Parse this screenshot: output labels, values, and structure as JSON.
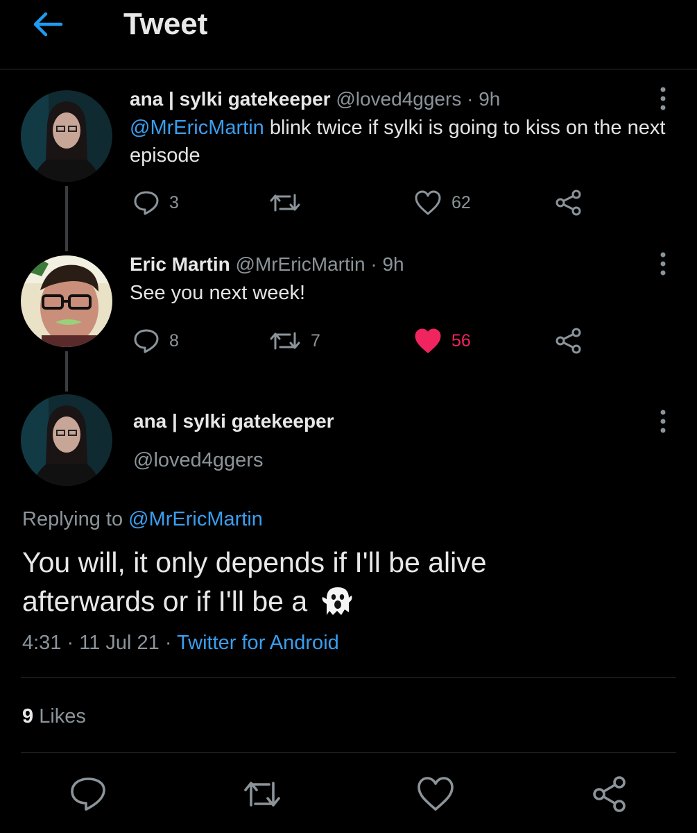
{
  "header": {
    "title": "Tweet",
    "back_icon": "arrow-left-icon",
    "accent": "#1d9bf0"
  },
  "tweets": [
    {
      "name": "ana | sylki gatekeeper",
      "handle": "@loved4ggers",
      "time": "· 9h",
      "mention": "@MrEricMartin",
      "text": " blink twice if sylki is going to kiss on the next episode",
      "replies": "3",
      "retweets": "",
      "likes": "62",
      "liked": false
    },
    {
      "name": "Eric Martin",
      "handle": "@MrEricMartin",
      "time": "· 9h",
      "text": "See you next week!",
      "replies": "8",
      "retweets": "7",
      "likes": "56",
      "liked": true
    }
  ],
  "main_tweet": {
    "name": "ana | sylki gatekeeper",
    "handle": "@loved4ggers",
    "replying_label": "Replying to ",
    "replying_handle": "@MrEricMartin",
    "text_line1": "You will, it only depends if I'll be alive",
    "text_line2": "afterwards or if I'll be a ",
    "emoji": "ghost",
    "time": "4:31",
    "date": "· 11 Jul 21 ·",
    "source": "Twitter for Android",
    "likes_count": "9",
    "likes_label": "Likes"
  },
  "colors": {
    "like": "#f0245e",
    "link": "#1d9bf0",
    "muted": "#8b949a"
  }
}
